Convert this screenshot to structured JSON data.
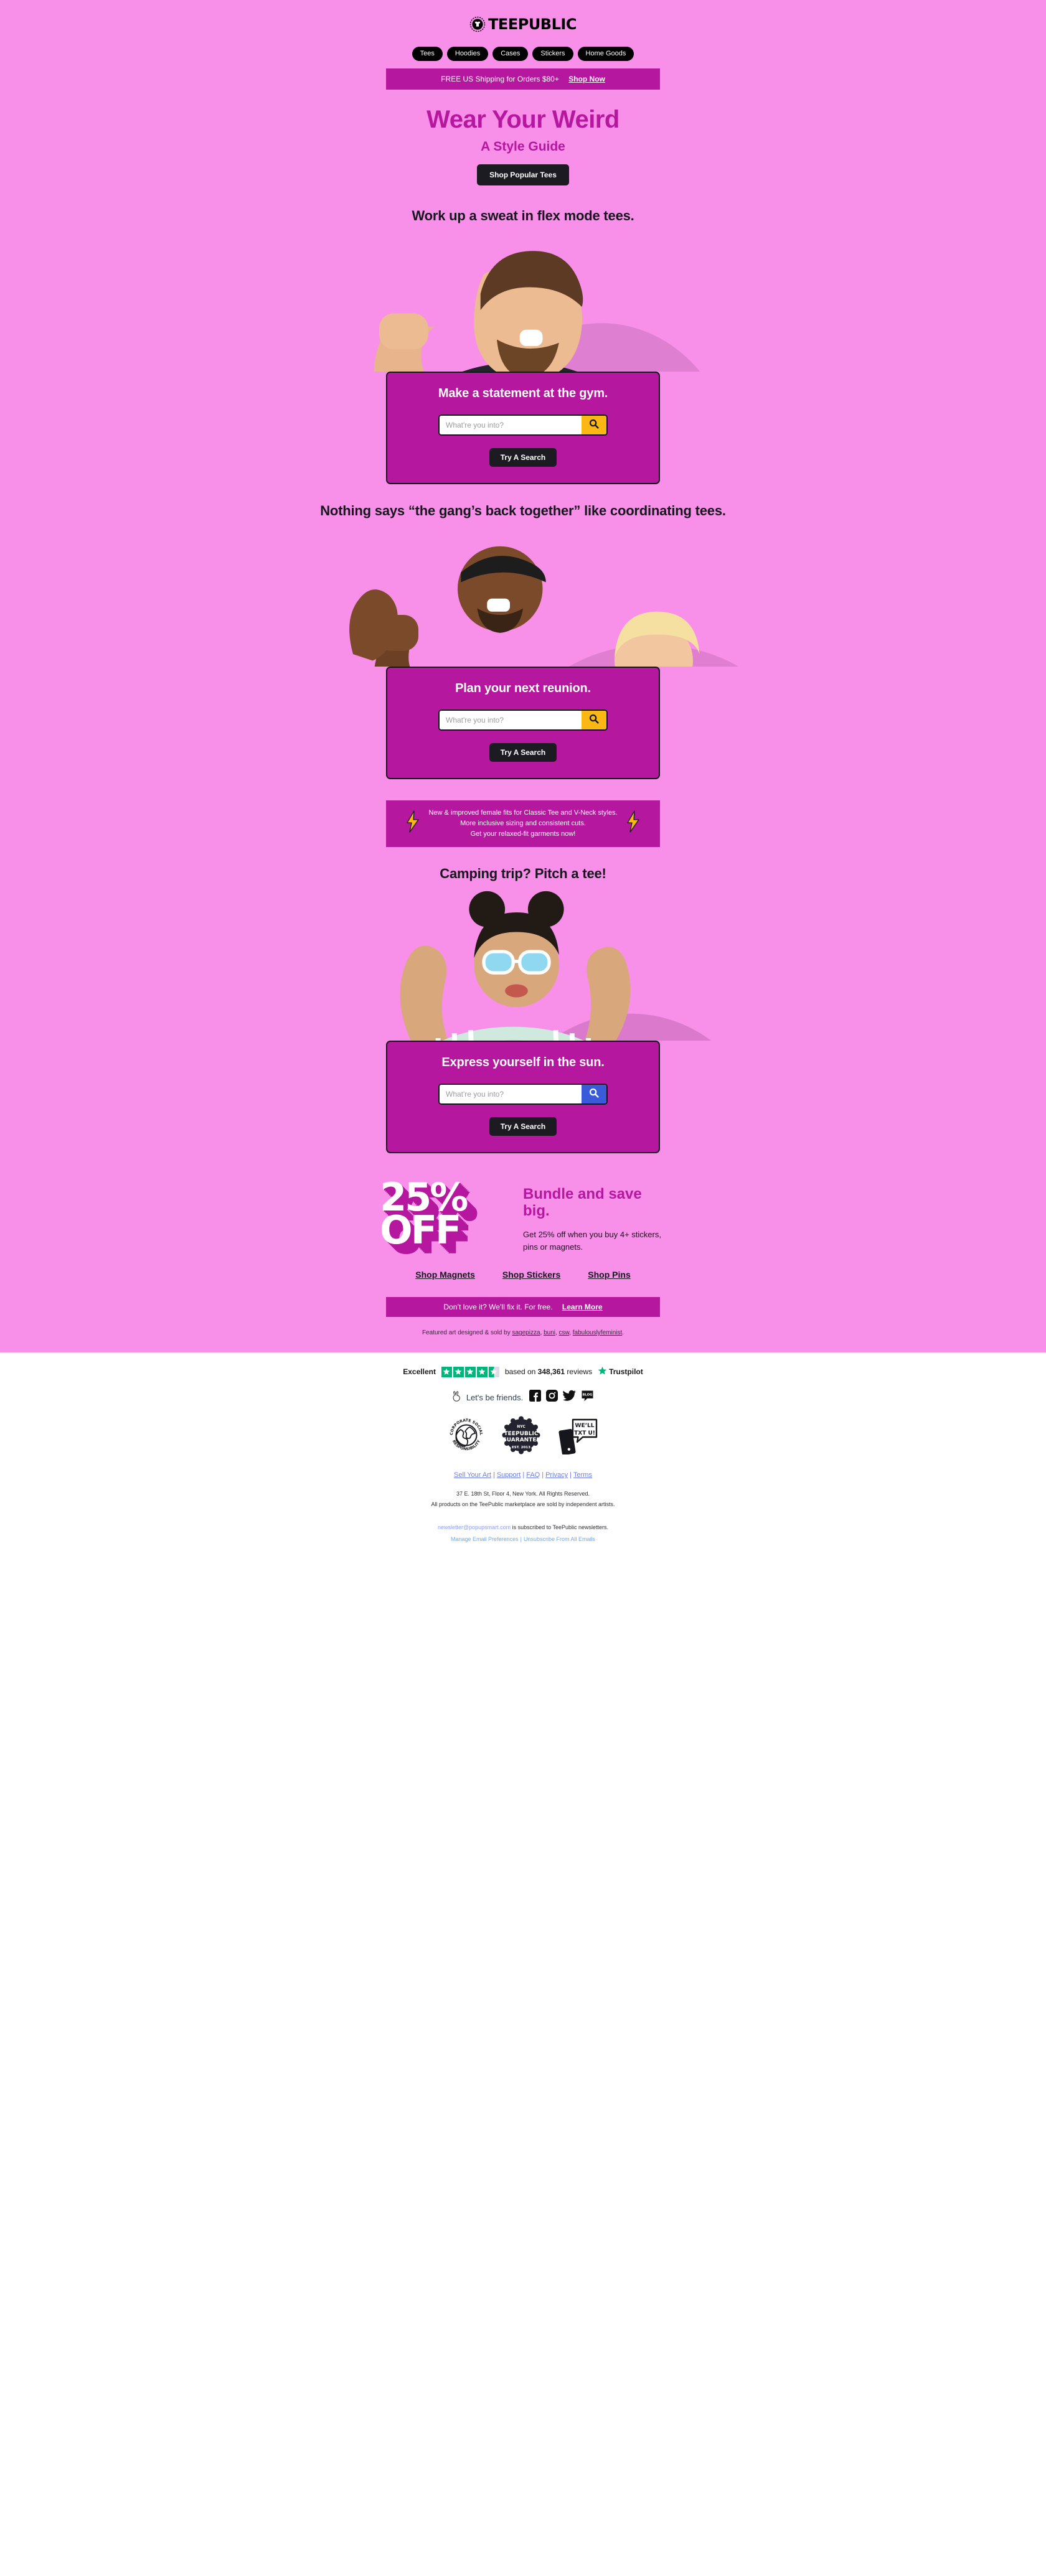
{
  "brand": {
    "logo_text": "TEEPUBLIC",
    "logo_icon": "tshirt-laurel-icon"
  },
  "nav": {
    "items": [
      {
        "label": "Tees"
      },
      {
        "label": "Hoodies"
      },
      {
        "label": "Cases"
      },
      {
        "label": "Stickers"
      },
      {
        "label": "Home Goods"
      }
    ]
  },
  "shipping_bar": {
    "text": "FREE US Shipping for Orders $80+",
    "link_label": "Shop Now"
  },
  "hero": {
    "title": "Wear Your Weird",
    "subtitle": "A Style Guide",
    "cta_label": "Shop Popular Tees"
  },
  "sections": [
    {
      "headline": "Work up a sweat in flex mode tees.",
      "card_title": "Make a statement at the gym.",
      "search_placeholder": "What're you into?",
      "search_button_color": "#fbb713",
      "cta_label": "Try A Search"
    },
    {
      "headline": "Nothing says “the gang’s back together” like coordinating tees.",
      "card_title": "Plan your next reunion.",
      "search_placeholder": "What're you into?",
      "search_button_color": "#fbb713",
      "cta_label": "Try A Search"
    },
    {
      "headline": "Camping trip? Pitch a tee!",
      "card_title": "Express yourself in the sun.",
      "search_placeholder": "What're you into?",
      "search_button_color": "#3a5bd9",
      "cta_label": "Try A Search"
    }
  ],
  "bolt_promo": {
    "line1": "New & improved female fits for Classic Tee and V-Neck styles.",
    "line2": "More inclusive sizing and consistent cuts.",
    "line3": "Get your relaxed-fit garments now!"
  },
  "bundle": {
    "discount_line1": "25%",
    "discount_line2": "OFF",
    "title": "Bundle and save big.",
    "description": "Get 25% off when you buy 4+ stickers, pins or magnets.",
    "links": [
      {
        "label": "Shop Magnets"
      },
      {
        "label": "Shop Stickers"
      },
      {
        "label": "Shop Pins"
      }
    ]
  },
  "guarantee_bar": {
    "text": "Don’t love it? We’ll fix it. For free.",
    "link_label": "Learn More"
  },
  "attribution": {
    "prefix": "Featured art designed & sold by ",
    "artists": [
      {
        "name": "sagepizza"
      },
      {
        "name": "buni"
      },
      {
        "name": "csw"
      },
      {
        "name": "fabulouslyfeminist"
      }
    ],
    "suffix": "."
  },
  "footer": {
    "trustpilot": {
      "rating_label": "Excellent",
      "stars_full": 4,
      "stars_half": 1,
      "based_on_prefix": "based on ",
      "review_count": "348,361",
      "based_on_suffix": " reviews",
      "brand": "Trustpilot",
      "star_color": "#00b67a"
    },
    "social": {
      "hand_icon": "peace-hand-icon",
      "label": "Let's be friends.",
      "icons": [
        {
          "name": "facebook-icon"
        },
        {
          "name": "instagram-icon"
        },
        {
          "name": "twitter-icon"
        },
        {
          "name": "blog-icon",
          "label": "BLOG"
        }
      ]
    },
    "badges": [
      {
        "name": "corporate-social-responsibility-badge",
        "line1": "CORPORATE SOCIAL",
        "line2": "RESPONSIBILITY"
      },
      {
        "name": "teepublic-guarantee-badge",
        "top": "NYC",
        "line1": "TEEPUBLIC",
        "line2": "GUARANTEE",
        "bottom": "EST. 2013"
      },
      {
        "name": "well-txt-u-badge",
        "line1": "WE’LL",
        "line2": "TXT U!"
      }
    ],
    "links": [
      {
        "label": "Sell Your Art"
      },
      {
        "label": "Support"
      },
      {
        "label": "FAQ"
      },
      {
        "label": "Privacy"
      },
      {
        "label": "Terms"
      }
    ],
    "legal_line1": "37 E. 18th St, Floor 4, New York. All Rights Reserved.",
    "legal_line2": "All products on the TeePublic marketplace are sold by independent artists.",
    "subscriber_email": "newsletter@popupsmart.com",
    "subscriber_suffix": " is subscribed to TeePublic newsletters.",
    "manage_label": "Manage Email Preferences",
    "unsubscribe_label": "Unsubscribe From All Emails"
  },
  "colors": {
    "background_pink": "#f88fe8",
    "magenta": "#b5179e",
    "dark": "#16161d",
    "gold": "#fbb713",
    "blue": "#3a5bd9"
  }
}
